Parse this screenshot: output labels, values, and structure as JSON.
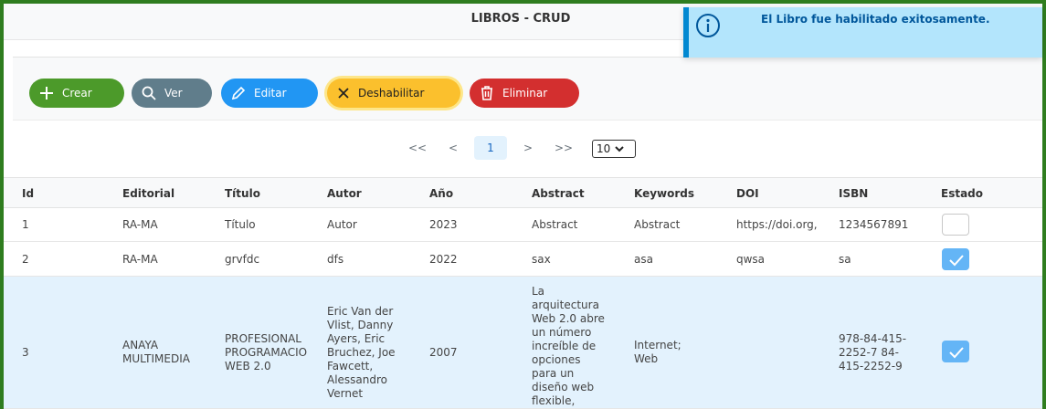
{
  "page": {
    "title": "LIBROS - CRUD"
  },
  "toast": {
    "message": "El Libro fue habilitado exitosamente.",
    "accent": "#0288d1"
  },
  "toolbar": {
    "crear_label": "Crear",
    "ver_label": "Ver",
    "editar_label": "Editar",
    "deshabilitar_label": "Deshabilitar",
    "eliminar_label": "Eliminar"
  },
  "pagination": {
    "first": "<<",
    "prev": "<",
    "current_page": "1",
    "next": ">",
    "last": ">>",
    "rows_per_page": "10"
  },
  "table": {
    "headers": [
      "Id",
      "Editorial",
      "Título",
      "Autor",
      "Año",
      "Abstract",
      "Keywords",
      "DOI",
      "ISBN",
      "Estado"
    ],
    "rows": [
      {
        "id": "1",
        "editorial": "RA-MA",
        "titulo": "Título",
        "autor": "Autor",
        "anio": "2023",
        "abstract": "Abstract",
        "keywords": "Abstract",
        "doi": "https://doi.org,",
        "isbn": "1234567891",
        "estado": false
      },
      {
        "id": "2",
        "editorial": "RA-MA",
        "titulo": "grvfdc",
        "autor": "dfs",
        "anio": "2022",
        "abstract": "sax",
        "keywords": "asa",
        "doi": "qwsa",
        "isbn": "sa",
        "estado": true
      },
      {
        "id": "3",
        "editorial": [
          "ANAYA",
          "MULTIMEDIA"
        ],
        "titulo": [
          "PROFESIONAL",
          "PROGRAMACIO",
          "WEB 2.0"
        ],
        "autor": [
          "Eric Van der",
          "Vlist, Danny",
          "Ayers, Eric",
          "Bruchez, Joe",
          "Fawcett,",
          "Alessandro",
          "Vernet"
        ],
        "anio": "2007",
        "abstract": [
          "La",
          "arquitectura",
          "Web 2.0 abre",
          "un número",
          "increíble de",
          "opciones",
          "para un",
          "diseño web",
          "flexible,"
        ],
        "keywords": [
          "Internet;",
          "Web"
        ],
        "doi": "",
        "isbn": [
          "978-84-415-",
          "2252-7 84-",
          "415-2252-9"
        ],
        "estado": true
      }
    ]
  },
  "colors": {
    "crear": "#4c9a2a",
    "ver": "#607d8b",
    "editar": "#2196f3",
    "deshabilitar": "#fbc02d",
    "eliminar": "#d32f2f",
    "selected_row": "#e3f2fd"
  }
}
